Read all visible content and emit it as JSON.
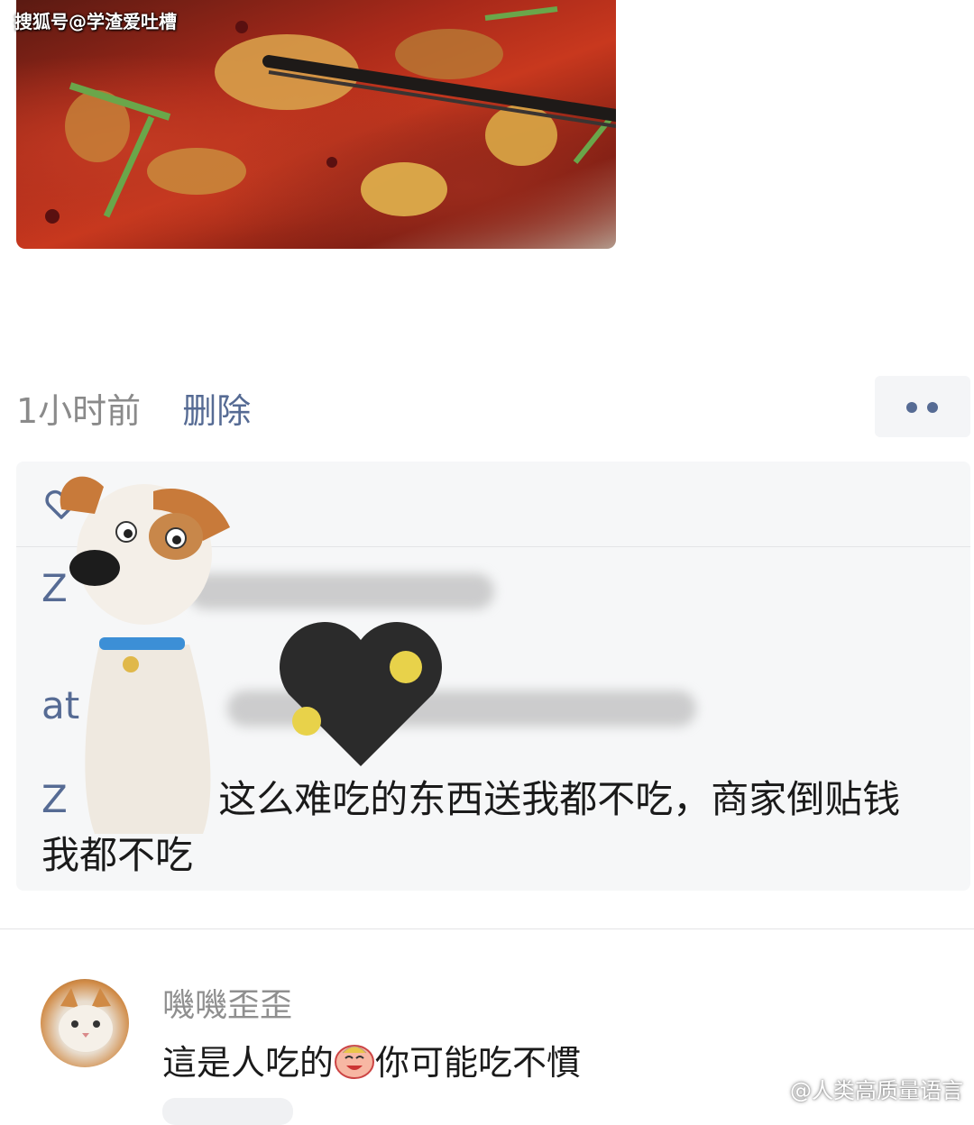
{
  "watermark_top": "搜狐号@学渣爱吐槽",
  "watermark_bottom": "@人类高质量语言",
  "post": {
    "time": "1小时前",
    "delete_label": "删除"
  },
  "comments": [
    {
      "author": "Z",
      "text": "",
      "redacted": true
    },
    {
      "author": "at",
      "text": "",
      "redacted": true
    },
    {
      "author": "Z",
      "separator": ":",
      "text": "这么难吃的东西送我都不吃，商家倒贴钱我都不吃",
      "redacted": false
    }
  ],
  "reply": {
    "author": "嘰嘰歪歪",
    "text_before": "這是人吃的",
    "emoji": "laughing-face",
    "text_after": "你可能吃不慣"
  },
  "icons": {
    "more": "more-dots-icon",
    "like": "heart-outline-icon"
  },
  "colors": {
    "link": "#566b94",
    "meta": "#8a8a8a",
    "panel": "#f6f7f8"
  }
}
